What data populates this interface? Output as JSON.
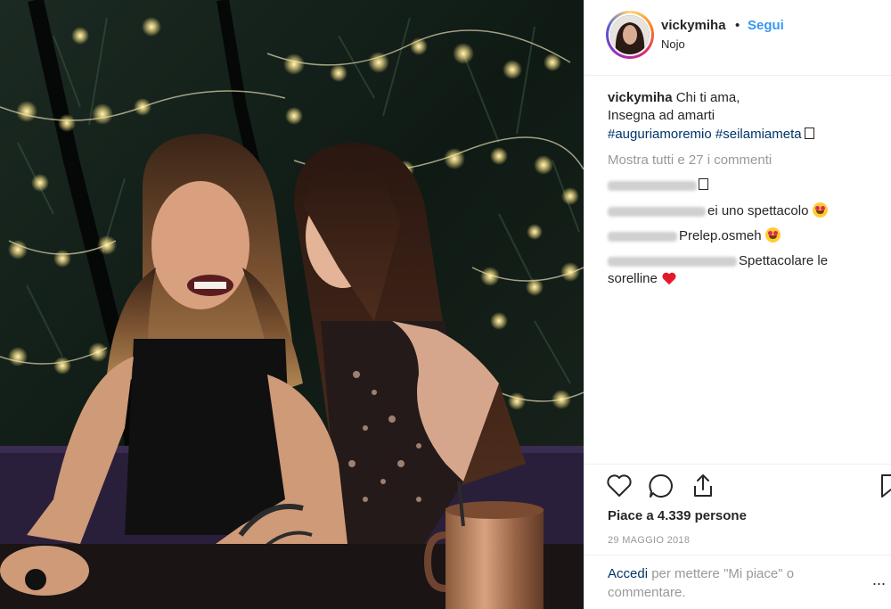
{
  "post": {
    "username": "vickymiha",
    "dot": "•",
    "follow_label": "Segui",
    "location": "Nojo"
  },
  "caption": {
    "username": "vickymiha",
    "line1": "Chi ti ama,",
    "line2": "Insegna ad amarti",
    "hashtag1": "#auguriamoremio",
    "hashtag2": "#seilamiameta"
  },
  "comments": {
    "show_all": "Mostra tutti e 27 i commenti",
    "items": [
      {
        "text": ""
      },
      {
        "text": "ei uno spettacolo",
        "emoji": "heart-eyes-emoji"
      },
      {
        "text": "Prelep.osmeh",
        "emoji": "heart-eyes-emoji"
      },
      {
        "text": "Spettacolare le",
        "text2": "sorelline",
        "emoji": "red-heart-emoji"
      }
    ]
  },
  "actions": {
    "icons": [
      "heart-icon",
      "comment-icon",
      "share-icon",
      "bookmark-icon"
    ]
  },
  "likes": "Piace a 4.339 persone",
  "date": "29 MAGGIO 2018",
  "login": {
    "link": "Accedi",
    "rest": " per mettere \"Mi piace\" o",
    "line2": "commentare."
  },
  "more_label": "...",
  "colors": {
    "link": "#3897f0",
    "hashtag": "#003569",
    "text": "#262626",
    "muted": "#999999",
    "heart": "#ed4956"
  }
}
